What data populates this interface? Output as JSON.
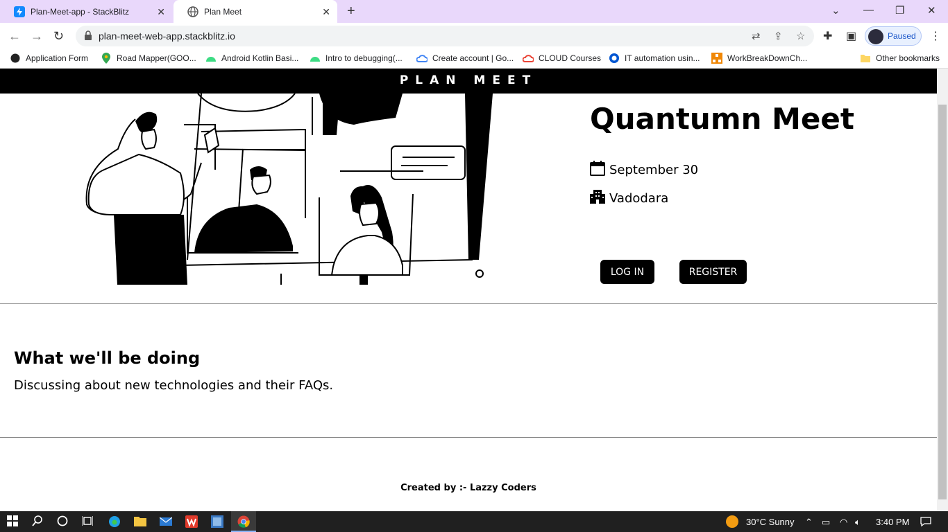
{
  "browser": {
    "tabs": [
      {
        "title": "Plan-Meet-app - StackBlitz",
        "active": false,
        "icon": "stackblitz-icon"
      },
      {
        "title": "Plan Meet",
        "active": true,
        "icon": "globe-icon"
      }
    ],
    "url": "plan-meet-web-app.stackblitz.io",
    "profile_status": "Paused",
    "bookmarks": [
      "Application Form",
      "Road Mapper(GOO...",
      "Android Kotlin Basi...",
      "Intro to debugging(...",
      "Create account | Go...",
      "CLOUD Courses",
      "IT automation usin...",
      "WorkBreakDownCh...",
      "Other bookmarks"
    ]
  },
  "site": {
    "brand": "PLAN MEET",
    "event_title": "Quantumn Meet",
    "date": "September 30",
    "location": "Vadodara",
    "login_label": "LOG IN",
    "register_label": "REGISTER",
    "section_heading": "What we'll be doing",
    "section_text": "Discussing about new technologies and their FAQs.",
    "footer": "Created by :- Lazzy Coders"
  },
  "taskbar": {
    "weather": "30°C  Sunny",
    "time": "3:40 PM"
  },
  "colors": {
    "tabbar": "#e9d8fb",
    "accent": "#000000"
  }
}
